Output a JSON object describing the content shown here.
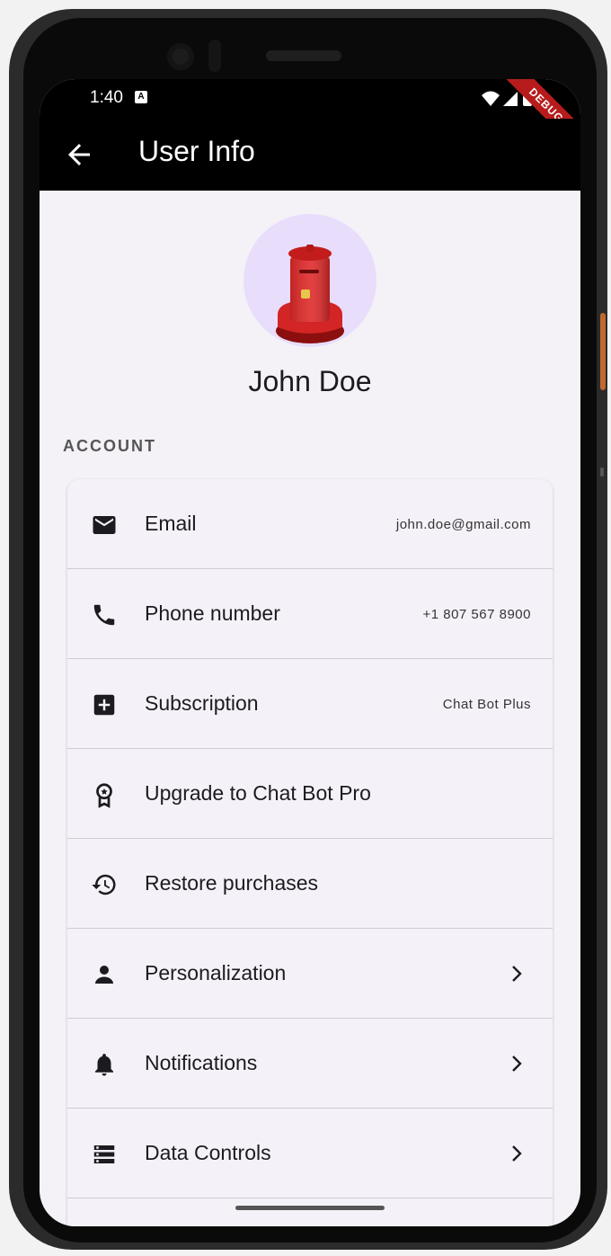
{
  "status_bar": {
    "time": "1:40",
    "badge": "A",
    "debug_label": "DEBUG"
  },
  "app_bar": {
    "title": "User Info"
  },
  "profile": {
    "name": "John Doe"
  },
  "account": {
    "section_label": "ACCOUNT",
    "items": [
      {
        "label": "Email",
        "value": "john.doe@gmail.com",
        "icon": "email-icon"
      },
      {
        "label": "Phone number",
        "value": "+1 807 567 8900",
        "icon": "phone-icon"
      },
      {
        "label": "Subscription",
        "value": "Chat Bot Plus",
        "icon": "add-box-icon"
      },
      {
        "label": "Upgrade to Chat Bot Pro",
        "value": "",
        "icon": "award-icon"
      },
      {
        "label": "Restore purchases",
        "value": "",
        "icon": "restore-icon"
      },
      {
        "label": "Personalization",
        "value": "",
        "icon": "person-icon",
        "chevron": true
      },
      {
        "label": "Notifications",
        "value": "",
        "icon": "bell-icon",
        "chevron": true
      },
      {
        "label": "Data Controls",
        "value": "",
        "icon": "list-icon",
        "chevron": true
      }
    ]
  },
  "colors": {
    "app_bar_bg": "#000000",
    "screen_bg": "#f4f1f7",
    "avatar_bg": "#e8ddfb",
    "debug_ribbon": "#b71c1c"
  }
}
